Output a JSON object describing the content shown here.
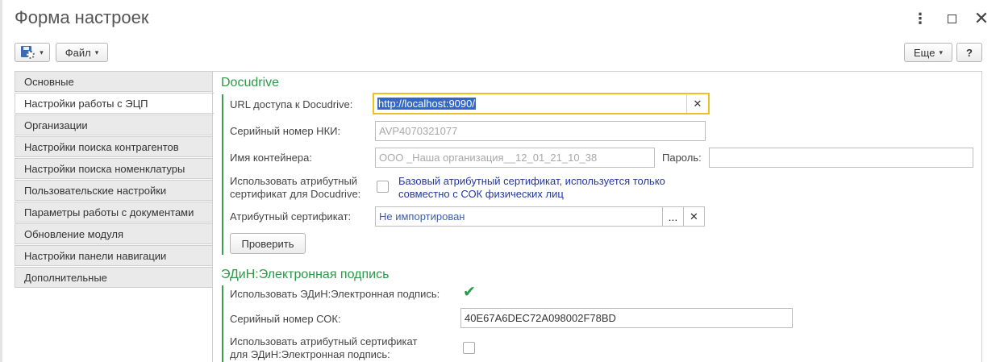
{
  "window": {
    "title": "Форма настроек",
    "more_icon": "⋮",
    "maximize_icon": "maximize-icon",
    "close_icon": "✕"
  },
  "toolbar": {
    "save_icon": "save-settings-icon",
    "file_label": "Файл",
    "more_label": "Еще",
    "help_label": "?"
  },
  "nav": {
    "items": [
      {
        "label": "Основные",
        "active": false
      },
      {
        "label": "Настройки работы с ЭЦП",
        "active": true
      },
      {
        "label": "Организации",
        "active": false
      },
      {
        "label": "Настройки поиска контрагентов",
        "active": false
      },
      {
        "label": "Настройки поиска номенклатуры",
        "active": false
      },
      {
        "label": "Пользовательские настройки",
        "active": false
      },
      {
        "label": "Параметры работы с документами",
        "active": false
      },
      {
        "label": "Обновление модуля",
        "active": false
      },
      {
        "label": "Настройки панели навигации",
        "active": false
      },
      {
        "label": "Дополнительные",
        "active": false
      }
    ]
  },
  "docudrive": {
    "title": "Docudrive",
    "url_label": "URL доступа к Docudrive:",
    "url_value": "http://localhost:9090/",
    "serial_label": "Серийный номер НКИ:",
    "serial_value": "AVP4070321077",
    "container_label": "Имя контейнера:",
    "container_value": "ООО _Наша организация__12_01_21_10_38",
    "password_label": "Пароль:",
    "password_value": "",
    "use_attr_label_1": "Использовать атрибутный",
    "use_attr_label_2": "сертификат для Docudrive:",
    "use_attr_checked": false,
    "note_1": "Базовый атрибутный сертификат, используется только",
    "note_2": "совместно с СОК физических лиц",
    "attr_cert_label": "Атрибутный сертификат:",
    "attr_cert_value": "Не импортирован",
    "select_button": "...",
    "clear_icon": "✕",
    "check_button": "Проверить"
  },
  "edin": {
    "title": "ЭДиН:Электронная подпись",
    "use_label": "Использовать ЭДиН:Электронная подпись:",
    "use_checked": true,
    "check_icon": "✔",
    "serial_label": "Серийный номер СОК:",
    "serial_value": "40E67A6DEC72A098002F78BD",
    "use_attr_label_1": "Использовать атрибутный сертификат",
    "use_attr_label_2": "для ЭДиН:Электронная подпись:",
    "use_attr_checked": false
  },
  "colors": {
    "section_title": "#2a9a47",
    "focus_border": "#f0c020",
    "selection": "#3367c9",
    "note_text": "#23399b"
  }
}
